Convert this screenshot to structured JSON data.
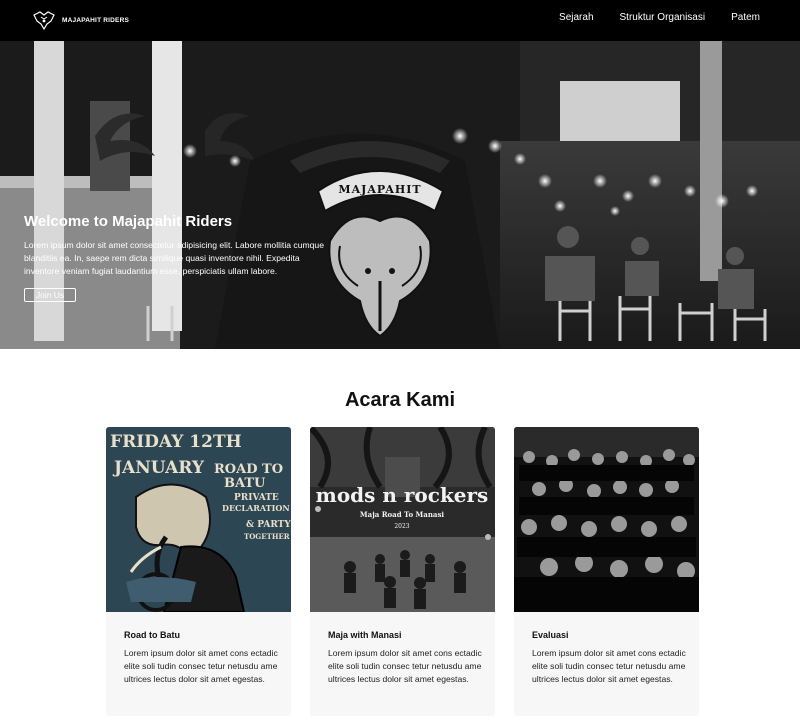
{
  "nav": {
    "brand": "Majapahit Riders",
    "links": [
      "Sejarah",
      "Struktur Organisasi",
      "Patem"
    ]
  },
  "hero": {
    "title": "Welcome to Majapahit Riders",
    "description": "Lorem ipsum dolor sit amet consectetur adipisicing elit. Labore mollitia cumque blanditiis ea. In, saepe rem dicta similique quasi inventore nihil. Expedita inventore veniam fugiat laudantium esse, perspiciatis ullam labore.",
    "button": "Join Us",
    "banner_text": "MAJAPAHIT"
  },
  "events": {
    "title": "Acara Kami",
    "cards": [
      {
        "title": "Road to Batu",
        "body": "Lorem ipsum dolor sit amet cons ectadic elite soli tudin consec tetur netusdu ame ultrices lectus dolor sit amet egestas.",
        "poster": {
          "line1": "FRIDAY 12TH",
          "line2": "JANUARY",
          "line3": "ROAD TO",
          "line4": "BATU",
          "line5": "PRIVATE",
          "line6": "DECLARATION",
          "line7": "& PARTY",
          "line8": "TOGETHER"
        }
      },
      {
        "title": "Maja with Manasi",
        "body": "Lorem ipsum dolor sit amet cons ectadic elite soli tudin consec tetur netusdu ame ultrices lectus dolor sit amet egestas.",
        "poster": {
          "headline": "mods n rockers",
          "subtitle": "Maja Road To Manasi",
          "year": "2023"
        }
      },
      {
        "title": "Evaluasi",
        "body": "Lorem ipsum dolor sit amet cons ectadic elite soli tudin consec tetur netusdu ame ultrices lectus dolor sit amet egestas."
      }
    ]
  },
  "colors": {
    "navbar": "#000000",
    "poster_blue": "#2d4654",
    "poster_cream": "#e8e0c8",
    "card_bg": "#f7f7f7"
  }
}
